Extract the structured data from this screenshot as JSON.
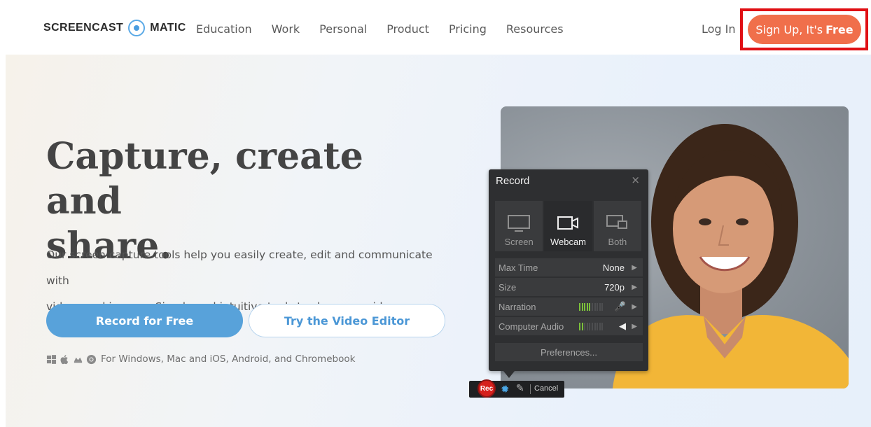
{
  "nav": {
    "logo_left": "SCREENCAST",
    "logo_right": "MATIC",
    "items": [
      "Education",
      "Work",
      "Personal",
      "Product",
      "Pricing",
      "Resources"
    ],
    "login": "Log In",
    "signup_main": "Sign Up, It's",
    "signup_bold": "Free"
  },
  "hero": {
    "title_line1": "Capture, create and",
    "title_line2": "share.",
    "desc_line1": "Our screen capture tools help you easily create, edit and communicate with",
    "desc_line2": "videos and images. Simple and intuitive tools to share your ideas.",
    "primary_button": "Record for Free",
    "secondary_button": "Try the Video Editor",
    "platforms_text": "For Windows, Mac and iOS, Android, and Chromebook",
    "platform_icons": [
      "windows-icon",
      "apple-icon",
      "android-icon",
      "chrome-icon"
    ]
  },
  "recorder": {
    "title": "Record",
    "close": "×",
    "modes": [
      "Screen",
      "Webcam",
      "Both"
    ],
    "active_mode": "Webcam",
    "rows": [
      {
        "label": "Max Time",
        "value": "None"
      },
      {
        "label": "Size",
        "value": "720p"
      },
      {
        "label": "Narration",
        "value": ""
      },
      {
        "label": "Computer Audio",
        "value": ""
      }
    ],
    "narration_level": 0.5,
    "audio_level": 0.2,
    "preferences": "Preferences...",
    "rec_button": "Rec",
    "cancel": "Cancel"
  },
  "colors": {
    "accent_blue": "#58a2da",
    "signup_orange": "#f06f4b",
    "highlight_red": "#e00f14"
  }
}
